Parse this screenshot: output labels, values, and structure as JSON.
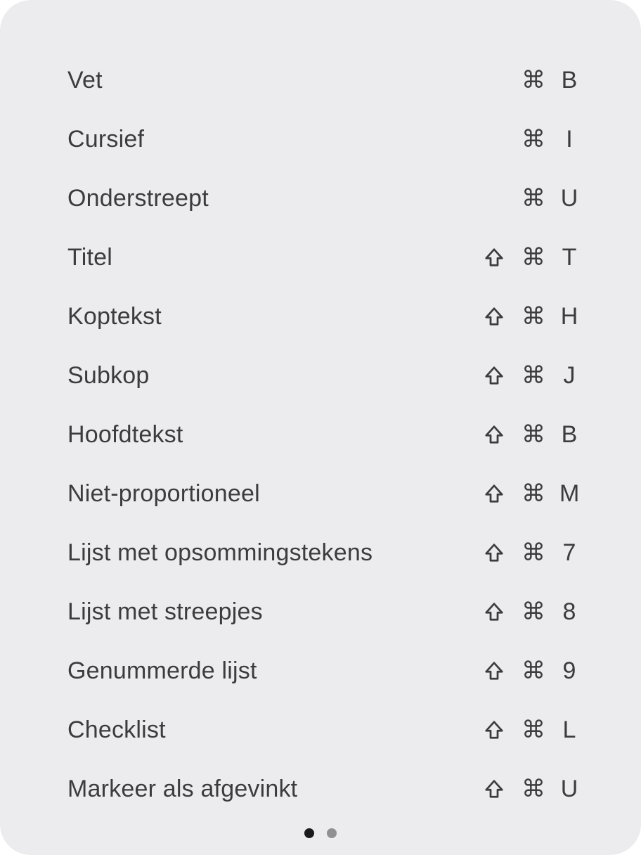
{
  "menu": {
    "items": [
      {
        "label": "Vet",
        "shift": false,
        "cmd": "⌘",
        "key": "B"
      },
      {
        "label": "Cursief",
        "shift": false,
        "cmd": "⌘",
        "key": "I"
      },
      {
        "label": "Onderstreept",
        "shift": false,
        "cmd": "⌘",
        "key": "U"
      },
      {
        "label": "Titel",
        "shift": true,
        "cmd": "⌘",
        "key": "T"
      },
      {
        "label": "Koptekst",
        "shift": true,
        "cmd": "⌘",
        "key": "H"
      },
      {
        "label": "Subkop",
        "shift": true,
        "cmd": "⌘",
        "key": "J"
      },
      {
        "label": "Hoofdtekst",
        "shift": true,
        "cmd": "⌘",
        "key": "B"
      },
      {
        "label": "Niet-proportioneel",
        "shift": true,
        "cmd": "⌘",
        "key": "M"
      },
      {
        "label": "Lijst met opsommingstekens",
        "shift": true,
        "cmd": "⌘",
        "key": "7"
      },
      {
        "label": "Lijst met streepjes",
        "shift": true,
        "cmd": "⌘",
        "key": "8"
      },
      {
        "label": "Genummerde lijst",
        "shift": true,
        "cmd": "⌘",
        "key": "9"
      },
      {
        "label": "Checklist",
        "shift": true,
        "cmd": "⌘",
        "key": "L"
      },
      {
        "label": "Markeer als afgevinkt",
        "shift": true,
        "cmd": "⌘",
        "key": "U"
      }
    ]
  },
  "pagination": {
    "total": 2,
    "active": 0
  }
}
